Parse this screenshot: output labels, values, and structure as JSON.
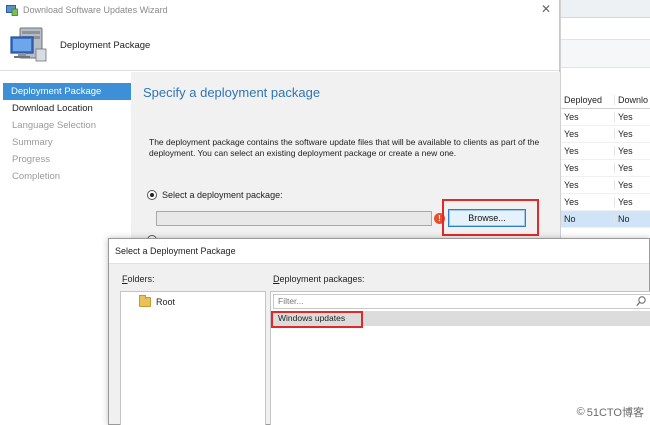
{
  "wizard": {
    "window_title": "Download Software Updates Wizard",
    "close_glyph": "✕",
    "header_title": "Deployment Package",
    "nav": [
      {
        "label": "Deployment Package",
        "state": "active"
      },
      {
        "label": "Download Location",
        "state": "next"
      },
      {
        "label": "Language Selection",
        "state": "disabled"
      },
      {
        "label": "Summary",
        "state": "disabled"
      },
      {
        "label": "Progress",
        "state": "disabled"
      },
      {
        "label": "Completion",
        "state": "disabled"
      }
    ],
    "content": {
      "heading": "Specify a deployment package",
      "description": "The deployment package contains the software update files that will be available to clients as part of the deployment. You can select an existing deployment package or create a new one.",
      "select_radio_label": "Select a deployment package:",
      "package_value": "",
      "browse_label": "Browse..."
    }
  },
  "background_table": {
    "columns": [
      "Deployed",
      "Downlo"
    ],
    "rows": [
      [
        "Yes",
        "Yes"
      ],
      [
        "Yes",
        "Yes"
      ],
      [
        "Yes",
        "Yes"
      ],
      [
        "Yes",
        "Yes"
      ],
      [
        "Yes",
        "Yes"
      ],
      [
        "Yes",
        "Yes"
      ],
      [
        "No",
        "No"
      ]
    ],
    "selected_row": 6
  },
  "dialog": {
    "title": "Select a Deployment Package",
    "folders_label_accel": "F",
    "folders_label_rest": "olders:",
    "packages_label_accel": "D",
    "packages_label_rest": "eployment packages:",
    "tree_root": "Root",
    "filter_placeholder": "Filter...",
    "packages": [
      "Windows updates"
    ]
  },
  "watermark": {
    "logo": "©",
    "text": "51CTO博客"
  },
  "colors": {
    "accent": "#3d8fd6",
    "heading": "#2e75b6",
    "highlight_box": "#e02a2a",
    "error": "#e8502e"
  }
}
